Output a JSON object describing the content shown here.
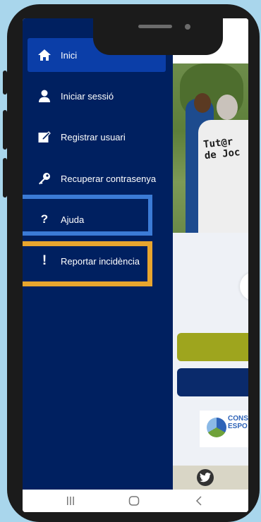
{
  "drawer": {
    "items": [
      {
        "label": "Inici",
        "icon": "home-icon",
        "active": true
      },
      {
        "label": "Iniciar sessió",
        "icon": "user-icon"
      },
      {
        "label": "Registrar usuari",
        "icon": "edit-icon"
      },
      {
        "label": "Recuperar contrasenya",
        "icon": "key-icon"
      },
      {
        "label": "Ajuda",
        "icon": "question-icon",
        "highlight": "#3b7bd6"
      },
      {
        "label": "Reportar incidència",
        "icon": "exclamation-icon",
        "highlight": "#e8a52e"
      }
    ]
  },
  "background": {
    "photo_text": "Tut@r de Joc",
    "partner_logo_text": "CONS ESPO",
    "footer_icon": "twitter-icon"
  },
  "navbar": {
    "icons": [
      "recent-apps-icon",
      "home-button-icon",
      "back-icon"
    ]
  },
  "colors": {
    "drawer_bg": "#002060",
    "active_item": "#0b3ea8",
    "highlight_blue": "#3b7bd6",
    "highlight_orange": "#e8a52e",
    "page_bg": "#a9d6ec"
  }
}
